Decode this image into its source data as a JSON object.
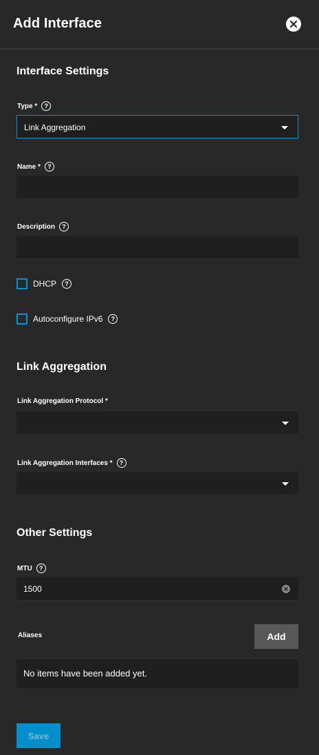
{
  "header": {
    "title": "Add Interface"
  },
  "sections": {
    "interface_settings": "Interface Settings",
    "link_aggregation": "Link Aggregation",
    "other_settings": "Other Settings"
  },
  "fields": {
    "type": {
      "label": "Type *",
      "value": "Link Aggregation"
    },
    "name": {
      "label": "Name *",
      "value": ""
    },
    "description": {
      "label": "Description",
      "value": ""
    },
    "dhcp": {
      "label": "DHCP",
      "checked": false
    },
    "autoconfigure_ipv6": {
      "label": "Autoconfigure IPv6",
      "checked": false
    },
    "lagg_protocol": {
      "label": "Link Aggregation Protocol *",
      "value": ""
    },
    "lagg_interfaces": {
      "label": "Link Aggregation Interfaces *",
      "value": ""
    },
    "mtu": {
      "label": "MTU",
      "value": "1500"
    }
  },
  "aliases": {
    "label": "Aliases",
    "add_label": "Add",
    "empty_text": "No items have been added yet."
  },
  "actions": {
    "save_label": "Save"
  },
  "icons": {
    "close": "close-icon",
    "help": "help-icon",
    "dropdown": "chevron-down-icon",
    "clear": "clear-icon"
  },
  "colors": {
    "background": "#282828",
    "input_bg": "#1f1f1f",
    "accent": "#0095d5",
    "add_button": "#585858"
  }
}
